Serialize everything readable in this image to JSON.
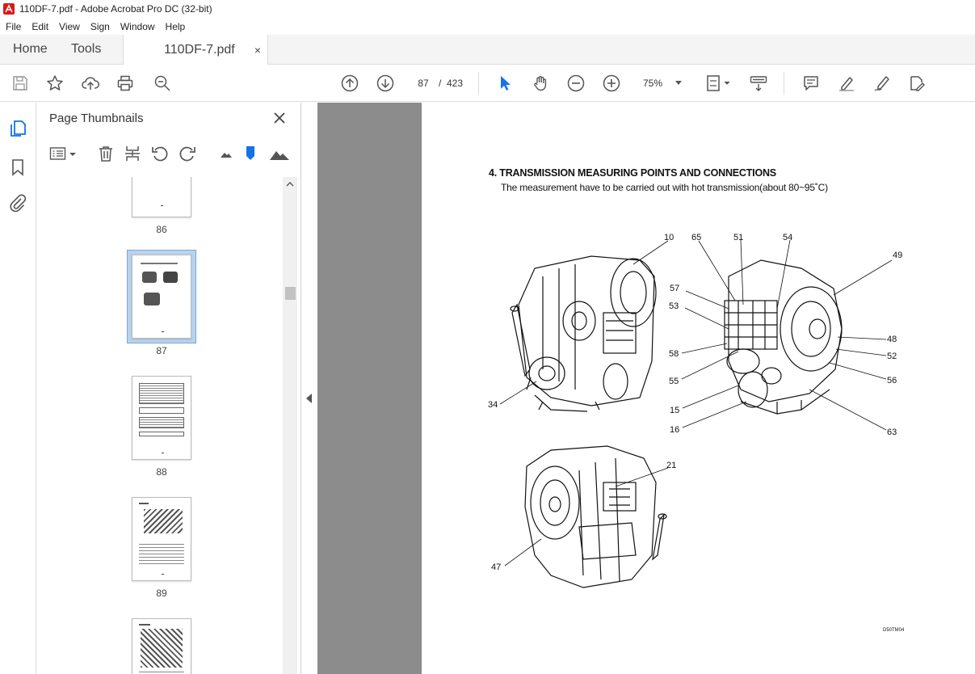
{
  "window": {
    "title": "110DF-7.pdf - Adobe Acrobat Pro DC (32-bit)"
  },
  "menu": [
    "File",
    "Edit",
    "View",
    "Sign",
    "Window",
    "Help"
  ],
  "tabs": {
    "home": "Home",
    "tools": "Tools",
    "document": "110DF-7.pdf",
    "close": "×"
  },
  "toolbar": {
    "current_page": "87",
    "separator": "/",
    "total_pages": "423",
    "zoom": "75%"
  },
  "panel": {
    "title": "Page Thumbnails",
    "thumbnails": [
      {
        "label": "86"
      },
      {
        "label": "87",
        "selected": true
      },
      {
        "label": "88"
      },
      {
        "label": "89"
      },
      {
        "label": ""
      }
    ]
  },
  "page": {
    "heading": "4. TRANSMISSION MEASURING POINTS AND CONNECTIONS",
    "subheading": "The measurement have to be carried out with hot transmission(about 80~95˚C)",
    "callouts": [
      "10",
      "65",
      "51",
      "54",
      "49",
      "57",
      "53",
      "48",
      "52",
      "58",
      "55",
      "56",
      "15",
      "16",
      "63",
      "34",
      "21",
      "47"
    ],
    "figure_code": "D50TM04"
  },
  "colors": {
    "accent": "#1473e6",
    "toolbar_bg": "#ffffff",
    "viewer_bg": "#8c8c8c",
    "selected_thumb": "#b9d3ee"
  }
}
